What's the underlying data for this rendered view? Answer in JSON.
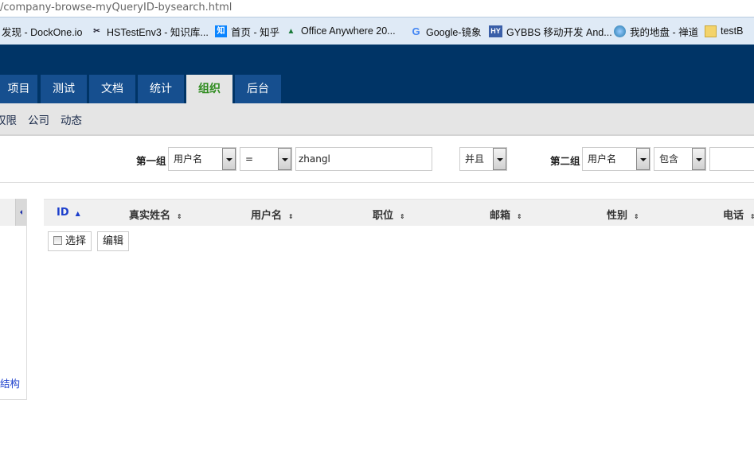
{
  "url": "/company-browse-myQueryID-bysearch.html",
  "bookmarks": [
    {
      "label": "发现 - DockOne.io",
      "icon": "none"
    },
    {
      "label": "HSTestEnv3 - 知识库...",
      "icon": "tools-icon"
    },
    {
      "label": "首页 - 知乎",
      "icon": "zhihu-icon",
      "glyph": "知"
    },
    {
      "label": "Office Anywhere 20...",
      "icon": "office-anywhere-icon"
    },
    {
      "label": "Google-镜象",
      "icon": "google-icon",
      "glyph": "G"
    },
    {
      "label": "GYBBS 移动开发 And...",
      "icon": "hy-icon",
      "glyph": "HY"
    },
    {
      "label": "我的地盘 - 禅道",
      "icon": "zentao-icon"
    },
    {
      "label": "testB",
      "icon": "folder-icon"
    }
  ],
  "tabs": [
    {
      "label": "项目"
    },
    {
      "label": "测试"
    },
    {
      "label": "文档"
    },
    {
      "label": "统计"
    },
    {
      "label": "组织",
      "active": true
    },
    {
      "label": "后台"
    }
  ],
  "subnav": [
    "权限",
    "公司",
    "动态"
  ],
  "filter": {
    "group1_label": "第一组",
    "group1_field": "用户名",
    "group1_op": "=",
    "group1_value": "zhangl",
    "join": "并且",
    "group2_label": "第二组",
    "group2_field": "用户名",
    "group2_op": "包含",
    "group2_value": ""
  },
  "sidebar": {
    "link": "结构"
  },
  "table": {
    "columns": [
      "ID",
      "真实姓名",
      "用户名",
      "职位",
      "邮箱",
      "性别",
      "电话"
    ]
  },
  "actions": {
    "select_all": "选择",
    "edit": "编辑"
  },
  "colors": {
    "header": "#003466",
    "tab": "#164f8f",
    "active_tab_text": "#2e8b1e",
    "link": "#1c3fcc"
  }
}
